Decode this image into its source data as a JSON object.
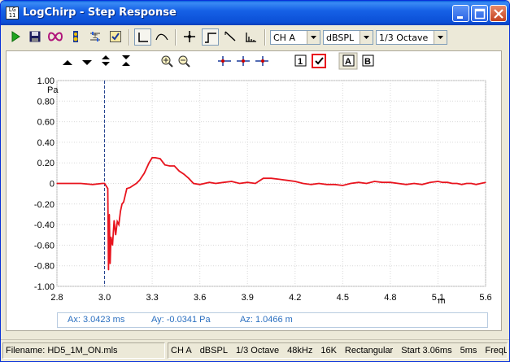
{
  "window": {
    "app_icon_text": "LG 11 11",
    "title": "LogChirp - Step Response"
  },
  "toolbar": {
    "icons": [
      "play-icon",
      "save-icon",
      "loop-icon",
      "speaker-icon",
      "measure-icon",
      "checklist-icon",
      "step-mode-icon",
      "curve-mode-icon",
      "cursor-icon",
      "step-response-icon",
      "impulse-decay-icon",
      "spectrum-icon"
    ],
    "channel": "CH A",
    "unit": "dBSPL",
    "smoothing": "1/3 Octave"
  },
  "plot_controls": {
    "icons": [
      "shift-up-icon",
      "shift-down-icon",
      "expand-vertical-icon",
      "compress-vertical-icon",
      "zoom-in-icon",
      "zoom-out-icon",
      "marker-left-icon",
      "marker-center-icon",
      "marker-right-icon",
      "box-1-icon",
      "checkbox-icon",
      "trace-a-icon",
      "trace-b-icon"
    ],
    "box_1_label": "1",
    "trace_a_label": "A",
    "trace_b_label": "B"
  },
  "chart_data": {
    "type": "line",
    "ylabel": "Pa",
    "xlabel": "m",
    "xlim": [
      2.8,
      5.6
    ],
    "ylim": [
      -1.0,
      1.0
    ],
    "xticks": [
      "2.8",
      "3.0",
      "3.3",
      "3.6",
      "3.9",
      "4.2",
      "4.5",
      "4.8",
      "5.1",
      "5.6"
    ],
    "x_tick_values": [
      2.8,
      3.0,
      3.3,
      3.6,
      3.9,
      4.2,
      4.5,
      4.8,
      5.1,
      5.6
    ],
    "yticks": [
      "1.00",
      "0.80",
      "0.60",
      "0.40",
      "0.20",
      "0",
      "-0.20",
      "-0.40",
      "-0.60",
      "-0.80",
      "-1.00"
    ],
    "y_tick_values": [
      1.0,
      0.8,
      0.6,
      0.4,
      0.2,
      0,
      -0.2,
      -0.4,
      -0.6,
      -0.8,
      -1.0
    ],
    "cursor_x": 3.0423,
    "grid": true,
    "line_color": "#e8141e",
    "cursor_color": "#1a3a8a",
    "series": [
      {
        "x": [
          2.8,
          2.9,
          2.95,
          2.99,
          3.0,
          3.02,
          3.025,
          3.03,
          3.035,
          3.04,
          3.05,
          3.06,
          3.07,
          3.08,
          3.09,
          3.1,
          3.11,
          3.12,
          3.14,
          3.16,
          3.18,
          3.2,
          3.22,
          3.25,
          3.28,
          3.3,
          3.32,
          3.35,
          3.38,
          3.41,
          3.44,
          3.47,
          3.5,
          3.53,
          3.56,
          3.6,
          3.63,
          3.66,
          3.7,
          3.75,
          3.8,
          3.85,
          3.9,
          3.95,
          4.0,
          4.05,
          4.1,
          4.15,
          4.2,
          4.25,
          4.3,
          4.35,
          4.4,
          4.45,
          4.5,
          4.55,
          4.6,
          4.65,
          4.7,
          4.75,
          4.8,
          4.85,
          4.9,
          4.95,
          5.0,
          5.05,
          5.1,
          5.15,
          5.2,
          5.25,
          5.3,
          5.35,
          5.4,
          5.45,
          5.5,
          5.55,
          5.6
        ],
        "y": [
          0.0,
          0.0,
          -0.01,
          0.0,
          0.0,
          -0.05,
          -0.84,
          -0.3,
          -0.78,
          -0.52,
          -0.6,
          -0.36,
          -0.5,
          -0.37,
          -0.4,
          -0.27,
          -0.2,
          -0.18,
          -0.05,
          -0.04,
          -0.02,
          0.0,
          0.03,
          0.1,
          0.2,
          0.25,
          0.25,
          0.24,
          0.18,
          0.17,
          0.17,
          0.12,
          0.09,
          0.05,
          0.0,
          -0.01,
          0.0,
          0.01,
          0.0,
          0.01,
          0.02,
          0.0,
          0.01,
          0.0,
          0.05,
          0.05,
          0.04,
          0.03,
          0.02,
          0.0,
          -0.01,
          0.0,
          -0.01,
          -0.01,
          -0.02,
          0.0,
          0.01,
          0.0,
          0.02,
          0.01,
          0.01,
          0.0,
          -0.01,
          0.0,
          -0.01,
          0.01,
          0.02,
          0.01,
          0.01,
          0.0,
          0.0,
          -0.01,
          0.0,
          0.0,
          -0.01,
          0.0,
          0.01
        ]
      }
    ]
  },
  "readout": {
    "ax": "Ax: 3.0423 ms",
    "ay": "Ay: -0.0341 Pa",
    "az": "Az: 1.0466 m"
  },
  "status": {
    "filename": "Filename: HD5_1M_ON.mls",
    "items": [
      "CH A",
      "dBSPL",
      "1/3 Octave",
      "48kHz",
      "16K",
      "Rectangular",
      "Start 3.06ms",
      "5ms",
      "FreqL"
    ]
  }
}
